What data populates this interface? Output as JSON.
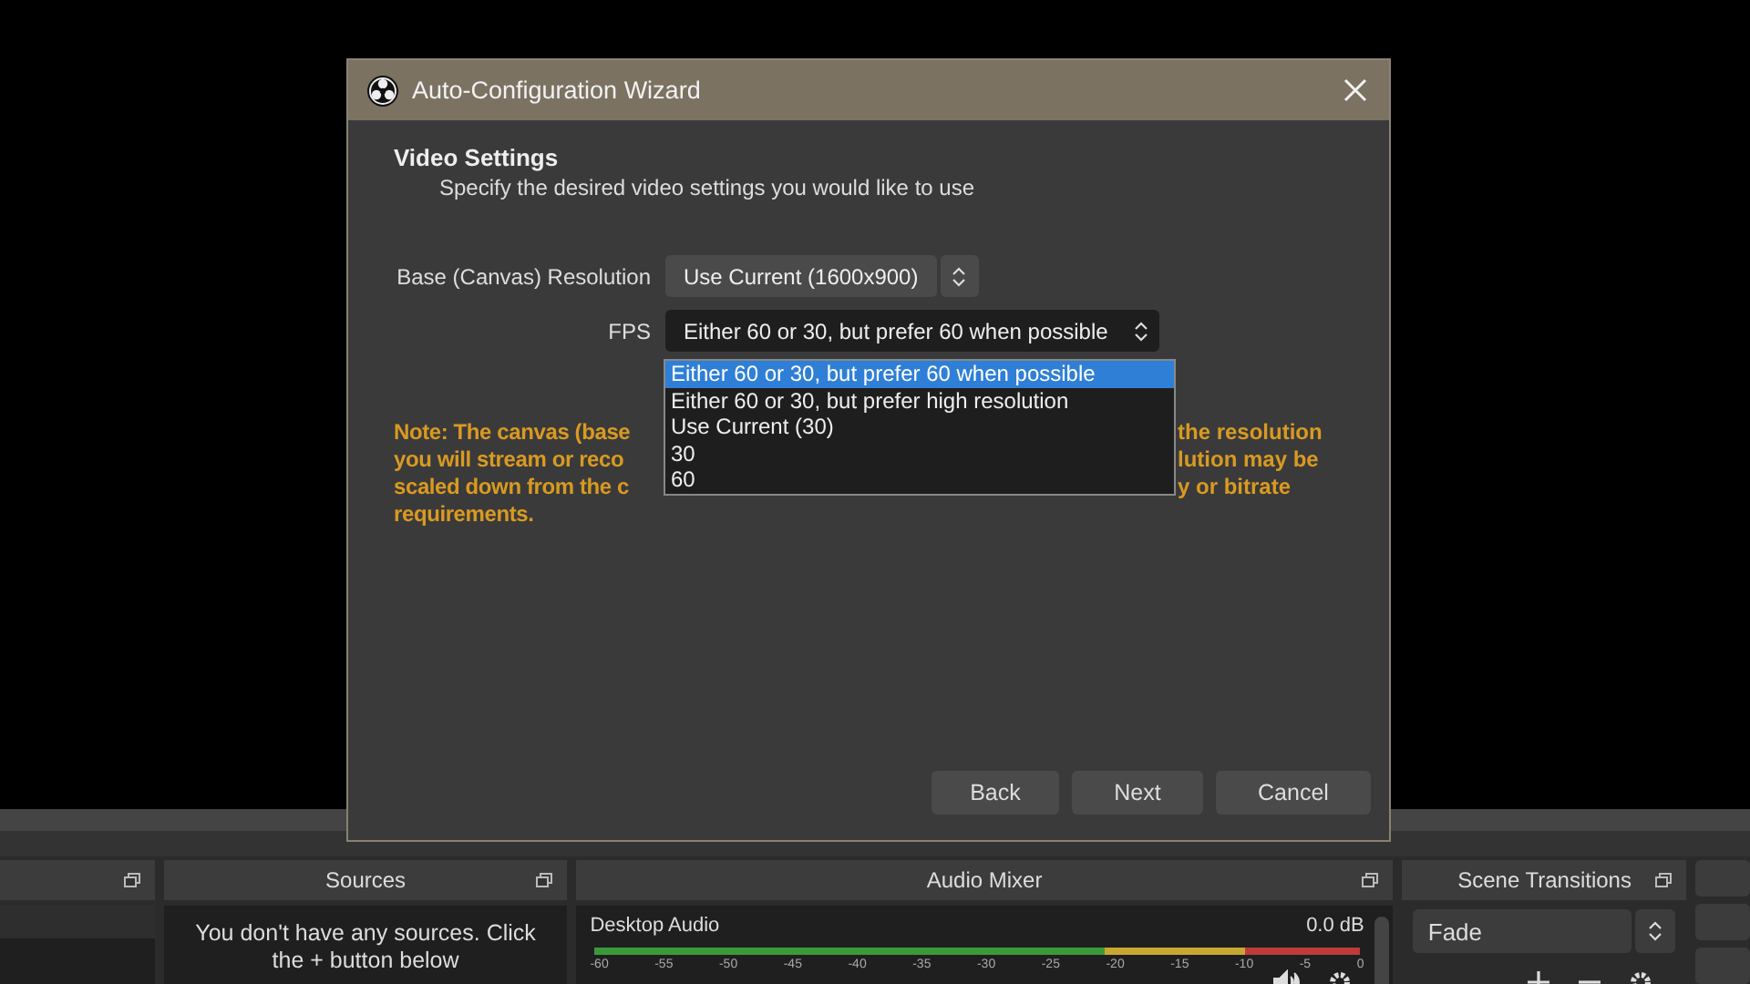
{
  "dialog": {
    "title": "Auto-Configuration Wizard",
    "heading": "Video Settings",
    "subheading": "Specify the desired video settings you would like to use",
    "fields": [
      {
        "label": "Base (Canvas) Resolution",
        "value": "Use Current (1600x900)",
        "kind": "combo"
      },
      {
        "label": "FPS",
        "value": "Either 60 or 30, but prefer 60 when possible",
        "kind": "select"
      }
    ],
    "dropdown": {
      "options": [
        {
          "label": "Either 60 or 30, but prefer 60 when possible",
          "selected": true
        },
        {
          "label": "Either 60 or 30, but prefer high resolution",
          "selected": false
        },
        {
          "label": "Use Current (30)",
          "selected": false
        },
        {
          "label": "30",
          "selected": false
        },
        {
          "label": "60",
          "selected": false
        }
      ]
    },
    "note_lines": [
      {
        "left": "Note: The canvas (base",
        "right": "the resolution"
      },
      {
        "left": "you will stream or reco",
        "right": "lution may be"
      },
      {
        "left": "scaled down from the c",
        "right": "y or bitrate"
      },
      {
        "left": "requirements."
      }
    ],
    "buttons": [
      "Back",
      "Next",
      "Cancel"
    ]
  },
  "docks": {
    "sources": {
      "title": "Sources",
      "empty_message": "You don't have any sources. Click the + button below"
    },
    "audio_mixer": {
      "title": "Audio Mixer",
      "channels": [
        {
          "name": "Desktop Audio",
          "reading": "0.0 dB"
        }
      ],
      "scale": [
        "-60",
        "-55",
        "-50",
        "-45",
        "-40",
        "-35",
        "-30",
        "-25",
        "-20",
        "-15",
        "-10",
        "-5",
        "0"
      ]
    },
    "scene_transitions": {
      "title": "Scene Transitions",
      "transition": "Fade"
    }
  }
}
